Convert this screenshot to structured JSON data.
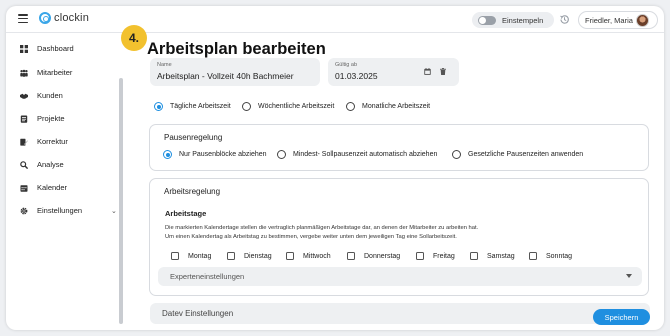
{
  "app": {
    "logo_text": "clockin"
  },
  "header": {
    "stamp_label": "Einstempeln",
    "user_name": "Friedler, Maria"
  },
  "sidebar": {
    "items": [
      {
        "label": "Dashboard",
        "icon": "dashboard-icon"
      },
      {
        "label": "Mitarbeiter",
        "icon": "users-icon"
      },
      {
        "label": "Kunden",
        "icon": "handshake-icon"
      },
      {
        "label": "Projekte",
        "icon": "clipboard-icon"
      },
      {
        "label": "Korrektur",
        "icon": "edit-icon"
      },
      {
        "label": "Analyse",
        "icon": "magnifier-icon"
      },
      {
        "label": "Kalender",
        "icon": "calendar-icon"
      },
      {
        "label": "Einstellungen",
        "icon": "gear-icon"
      }
    ]
  },
  "step_badge": "4.",
  "page_title": "Arbeitsplan bearbeiten",
  "form": {
    "name": {
      "label": "Name",
      "value": "Arbeitsplan - Vollzeit 40h Bachmeier"
    },
    "valid_from": {
      "label": "Gültig ab",
      "value": "01.03.2025"
    }
  },
  "plan_type": {
    "options": [
      "Tägliche Arbeitszeit",
      "Wöchentliche Arbeitszeit",
      "Monatliche Arbeitszeit"
    ],
    "selected": "Tägliche Arbeitszeit"
  },
  "pause": {
    "title": "Pausenregelung",
    "options": [
      "Nur Pausenblöcke abziehen",
      "Mindest- Sollpausenzeit automatisch abziehen",
      "Gesetzliche Pausenzeiten anwenden"
    ],
    "selected": "Nur Pausenblöcke abziehen"
  },
  "work": {
    "title": "Arbeitsregelung",
    "subtitle": "Arbeitstage",
    "desc_line1": "Die markierten Kalendertage stellen die vertraglich planmäßigen Arbeitstage dar, an denen der Mitarbeiter zu arbeiten hat.",
    "desc_line2": "Um einen Kalendertag als Arbeitstag zu bestimmen, vergebe weiter unten dem jeweiligen Tag eine Sollarbeitszeit.",
    "days": [
      "Montag",
      "Dienstag",
      "Mittwoch",
      "Donnerstag",
      "Freitag",
      "Samstag",
      "Sonntag"
    ],
    "expert_label": "Experteneinstellungen"
  },
  "datev_label": "Datev Einstellungen",
  "save_label": "Speichern",
  "colors": {
    "accent": "#1f8fe0",
    "badge": "#f2c12e",
    "logo": "#3aa6e8"
  }
}
